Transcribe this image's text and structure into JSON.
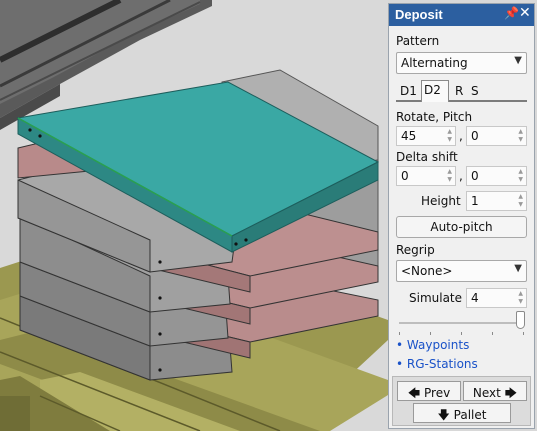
{
  "panel": {
    "title": "Deposit",
    "pin_icon": "pin-icon",
    "close_icon": "close-icon",
    "pattern_label": "Pattern",
    "pattern_value": "Alternating",
    "tabs": [
      {
        "label": "D1",
        "active": false
      },
      {
        "label": "D2",
        "active": true
      },
      {
        "label": "R",
        "active": false
      },
      {
        "label": "S",
        "active": false
      }
    ],
    "rotate_pitch_label": "Rotate, Pitch",
    "rotate_value": "45",
    "pitch_value": "0",
    "delta_shift_label": "Delta shift",
    "delta_x_value": "0",
    "delta_y_value": "0",
    "comma": ",",
    "height_label": "Height",
    "height_value": "1",
    "autopitch_label": "Auto-pitch",
    "regrip_label": "Regrip",
    "regrip_value": "<None>",
    "simulate_label": "Simulate",
    "simulate_value": "4",
    "simulate_level_fraction": 1.0,
    "links": [
      "Waypoints",
      "RG-Stations"
    ],
    "bullet": "•",
    "prev_label": "Prev",
    "next_label": "Next",
    "pallet_label": "Pallet"
  },
  "colors": {
    "titlebar": "#2c5fa0",
    "teal_layer": "#3aa8a4",
    "pink_layer": "#b88a8a",
    "gray_layer": "#9a9a9a",
    "pallet": "#a8a55a",
    "link": "#1a52c8"
  }
}
